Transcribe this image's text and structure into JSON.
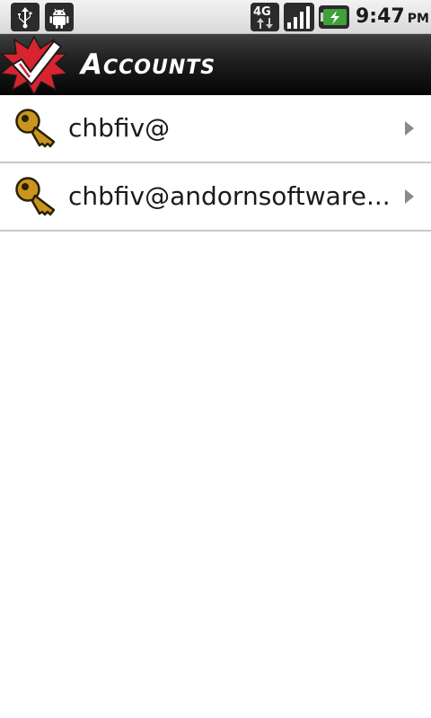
{
  "status_bar": {
    "icons": [
      "usb-icon",
      "android-debug-icon",
      "4g-network-icon",
      "signal-strength-icon",
      "battery-charging-icon"
    ],
    "network_label": "4G",
    "time": "9:47",
    "ampm": "PM"
  },
  "title_bar": {
    "title": "Accounts",
    "logo": "checkmark-logo-icon"
  },
  "accounts": [
    {
      "label": "chbfiv@",
      "icon": "key-icon"
    },
    {
      "label": "chbfiv@andornsoftware...",
      "icon": "key-icon"
    }
  ],
  "colors": {
    "title_bar_bg": "#1e1e1e",
    "key_gold": "#c8961e",
    "logo_red": "#d8242f",
    "divider": "#c8c8c8",
    "battery_green": "#3fa13a"
  }
}
